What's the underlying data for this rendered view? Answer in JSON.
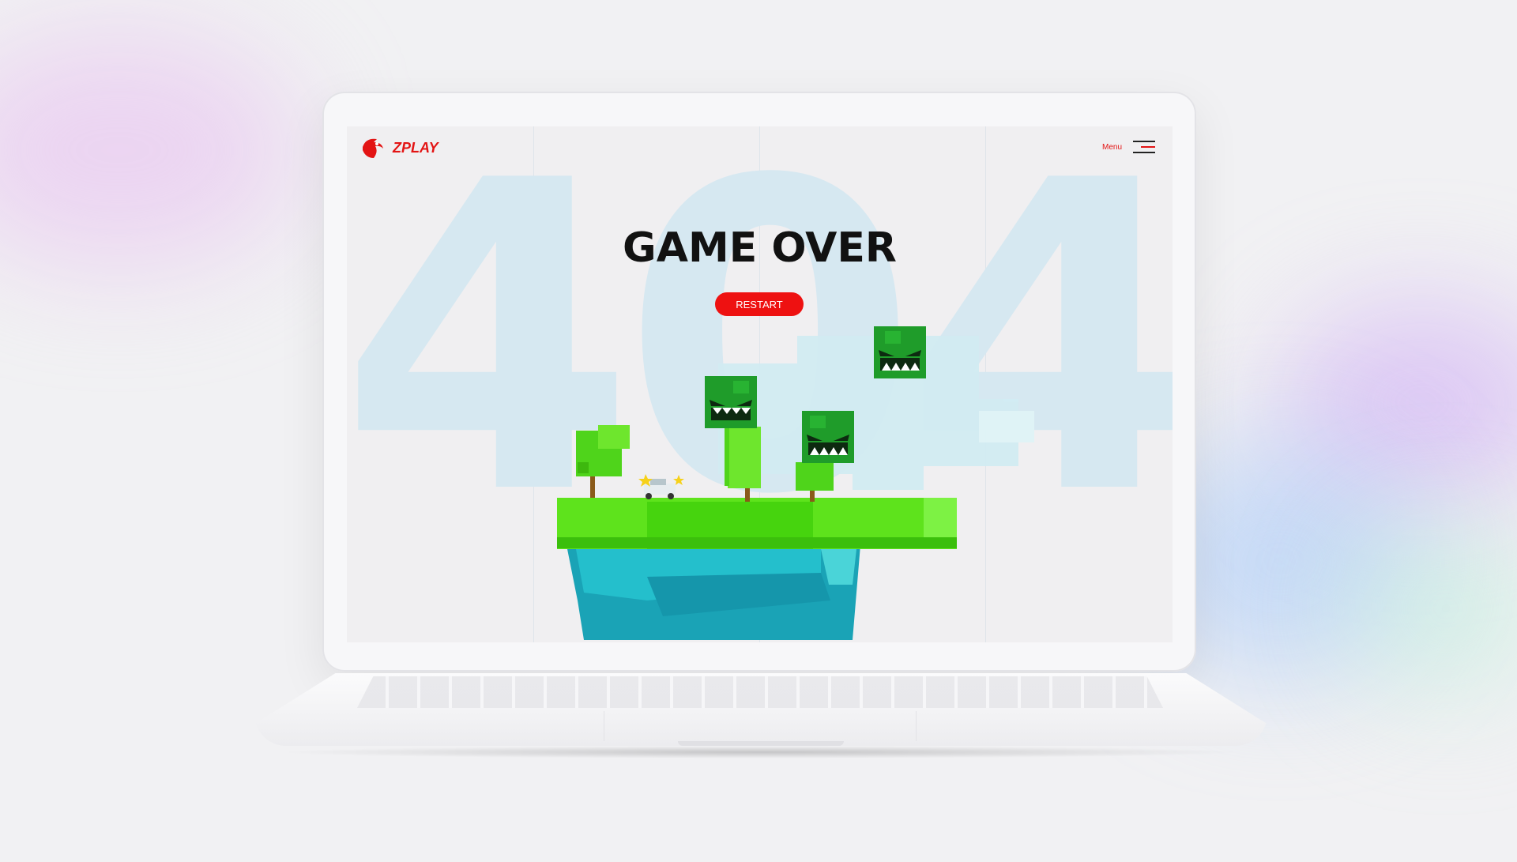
{
  "site": {
    "logo_text": "ZPLAY",
    "menu_label": "Menu"
  },
  "hero": {
    "background_code": "404",
    "title": "GAME OVER",
    "restart_label": "RESTART"
  },
  "colors": {
    "brand_red": "#e31414",
    "grass": "#5ee31c",
    "rock": "#1fb8c6",
    "monster": "#1f9c2a"
  },
  "icons": [
    "zplay-logo-icon",
    "hamburger-menu-icon",
    "monster-icon",
    "tree-icon",
    "floating-island-icon"
  ]
}
